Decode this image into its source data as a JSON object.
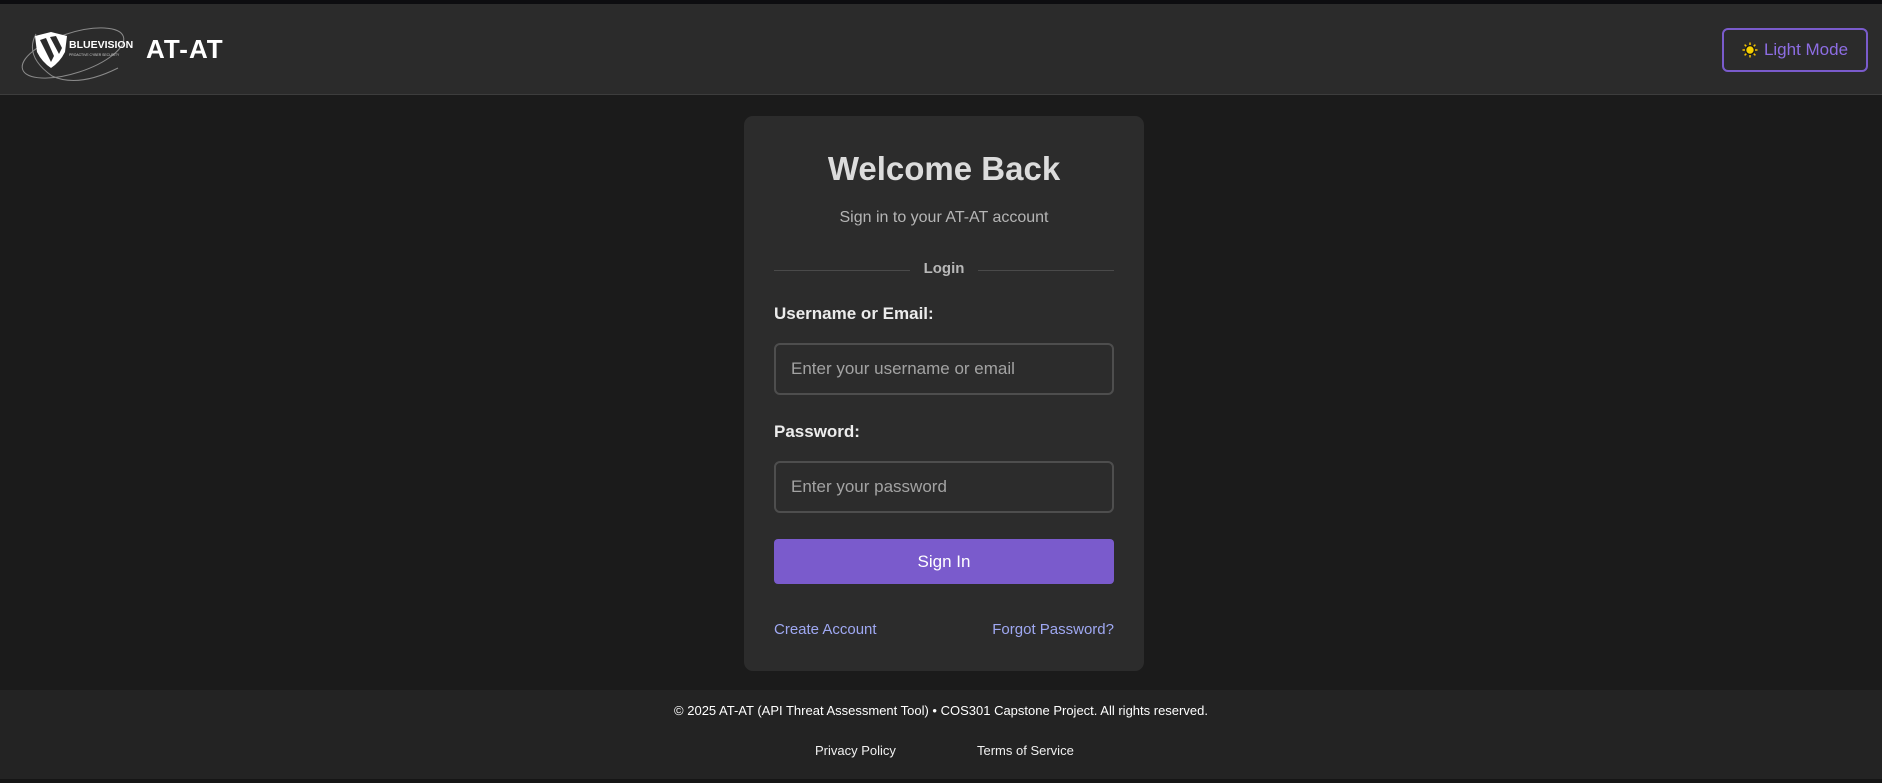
{
  "header": {
    "logo_text": "BLUEVISION",
    "logo_tagline": "PROACTIVE CYBER SECURITY",
    "app_title": "AT-AT",
    "theme_toggle_label": "Light Mode",
    "theme_toggle_icon": "sun-icon"
  },
  "login_card": {
    "title": "Welcome Back",
    "subtitle": "Sign in to your AT-AT account",
    "divider_label": "Login",
    "username": {
      "label": "Username or Email:",
      "placeholder": "Enter your username or email",
      "value": ""
    },
    "password": {
      "label": "Password:",
      "placeholder": "Enter your password",
      "value": ""
    },
    "submit_label": "Sign In",
    "create_account_label": "Create Account",
    "forgot_password_label": "Forgot Password?"
  },
  "footer": {
    "copyright": "© 2025 AT-AT (API Threat Assessment Tool) • COS301 Capstone Project. All rights reserved.",
    "links": [
      "Privacy Policy",
      "Terms of Service"
    ]
  },
  "colors": {
    "accent": "#7a5bcc",
    "link": "#9fa8f2",
    "background": "#1b1b1b",
    "card": "#2c2c2c"
  }
}
